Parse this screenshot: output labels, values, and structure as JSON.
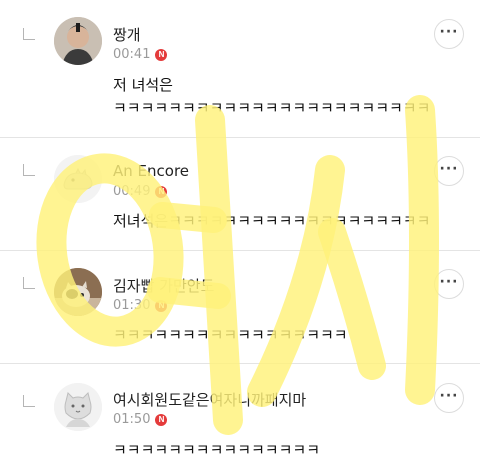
{
  "comments": [
    {
      "nickname": "짱개",
      "time": "00:41",
      "new_badge": "N",
      "lines": [
        "저 녀석은",
        "ㅋㅋㅋㅋㅋㅋㅋㅋㅋㅋㅋㅋㅋㅋㅋㅋㅋㅋㅋㅋㅋㅋㅋ"
      ],
      "avatar_icon": "profile-photo-icon"
    },
    {
      "nickname": "An Encore",
      "time": "00:49",
      "new_badge": "N",
      "lines": [
        "저녀석은ㅋㅋㅋㅋㅋㅋㅋㅋㅋㅋㅋㅋㅋㅋㅋㅋㅋㅋㅋ"
      ],
      "avatar_icon": "dinosaur-avatar-icon"
    },
    {
      "nickname": "김자빱 가만안도",
      "time": "01:30",
      "new_badge": "N",
      "lines": [
        "ㅋㅋㅋㅋㅋㅋㅋㅋㅋㅋㅋㅋㅋㅋㅋㅋㅋ"
      ],
      "avatar_icon": "cat-photo-icon"
    },
    {
      "nickname": "여시회원도같은여자니까패지마",
      "time": "01:50",
      "new_badge": "N",
      "lines": [
        "ㅋㅋㅋㅋㅋㅋㅋㅋㅋㅋㅋㅋㅋㅋㅋ"
      ],
      "avatar_icon": "cat-avatar-icon"
    }
  ],
  "more_label": "···",
  "watermark": "여시",
  "colors": {
    "new_badge": "#e43b3b",
    "watermark": "#fff27a",
    "divider": "#e4e4e4"
  }
}
